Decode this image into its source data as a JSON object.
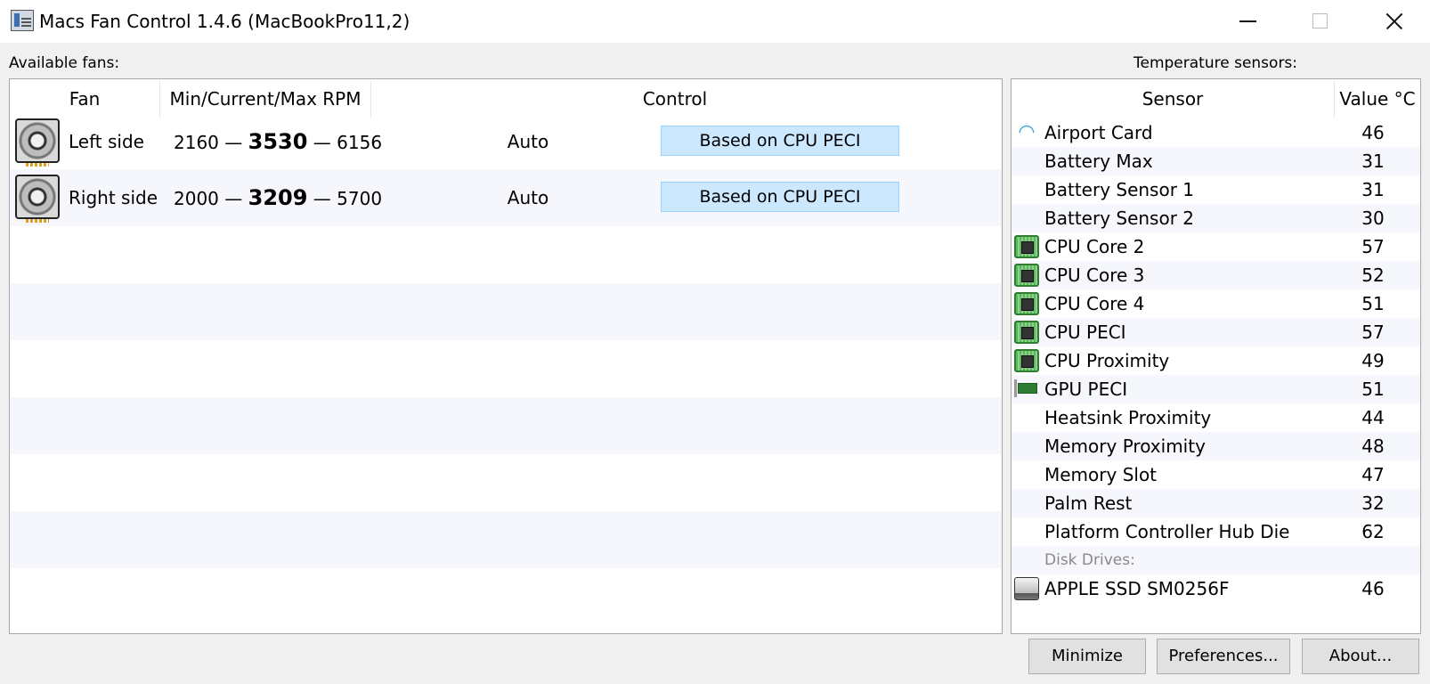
{
  "window": {
    "title": "Macs Fan Control 1.4.6 (MacBookPro11,2)"
  },
  "fans_section": {
    "label": "Available fans:",
    "columns": {
      "fan": "Fan",
      "rpm": "Min/Current/Max RPM",
      "control": "Control"
    },
    "rows": [
      {
        "name": "Left side",
        "min": "2160",
        "current": "3530",
        "max": "6156",
        "separator": "—",
        "mode": "Auto",
        "control": "Based on CPU PECI"
      },
      {
        "name": "Right side",
        "min": "2000",
        "current": "3209",
        "max": "5700",
        "separator": "—",
        "mode": "Auto",
        "control": "Based on CPU PECI"
      }
    ]
  },
  "sensors_section": {
    "label": "Temperature sensors:",
    "columns": {
      "sensor": "Sensor",
      "value": "Value °C"
    },
    "rows": [
      {
        "icon": "wifi-icon",
        "name": "Airport Card",
        "value": "46"
      },
      {
        "icon": "",
        "name": "Battery Max",
        "value": "31"
      },
      {
        "icon": "",
        "name": "Battery Sensor 1",
        "value": "31"
      },
      {
        "icon": "",
        "name": "Battery Sensor 2",
        "value": "30"
      },
      {
        "icon": "cpu-chip-icon",
        "name": "CPU Core 2",
        "value": "57"
      },
      {
        "icon": "cpu-chip-icon",
        "name": "CPU Core 3",
        "value": "52"
      },
      {
        "icon": "cpu-chip-icon",
        "name": "CPU Core 4",
        "value": "51"
      },
      {
        "icon": "cpu-chip-icon",
        "name": "CPU PECI",
        "value": "57"
      },
      {
        "icon": "cpu-chip-icon",
        "name": "CPU Proximity",
        "value": "49"
      },
      {
        "icon": "gpu-card-icon",
        "name": "GPU PECI",
        "value": "51"
      },
      {
        "icon": "",
        "name": "Heatsink Proximity",
        "value": "44"
      },
      {
        "icon": "",
        "name": "Memory Proximity",
        "value": "48"
      },
      {
        "icon": "",
        "name": "Memory Slot",
        "value": "47"
      },
      {
        "icon": "",
        "name": "Palm Rest",
        "value": "32"
      },
      {
        "icon": "",
        "name": "Platform Controller Hub Die",
        "value": "62"
      },
      {
        "icon": "",
        "name": "Disk Drives:",
        "value": "",
        "group": true
      },
      {
        "icon": "ssd-drive-icon",
        "name": "APPLE SSD SM0256F",
        "value": "46"
      }
    ]
  },
  "buttons": {
    "minimize": "Minimize",
    "preferences": "Preferences...",
    "about": "About..."
  },
  "colors": {
    "control_button_bg": "#cce8ff",
    "control_button_border": "#99d1ff",
    "row_stripe": "#f5f7fc",
    "window_bg": "#f0f0f0"
  }
}
